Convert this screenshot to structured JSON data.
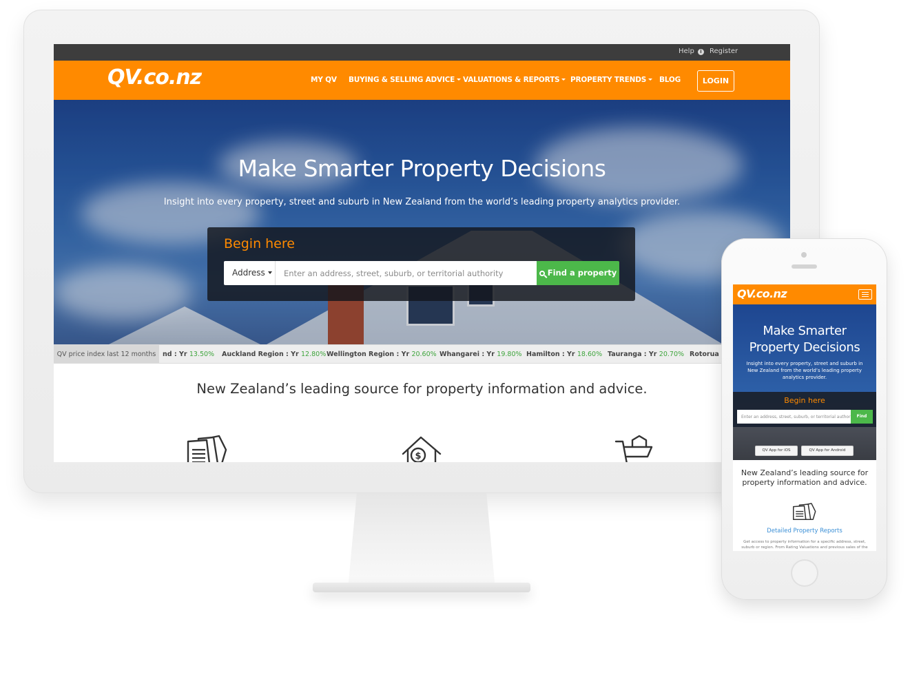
{
  "desktop": {
    "utility_links": {
      "help": "Help",
      "help_icon": "info-icon",
      "register": "Register"
    },
    "logo": "QV.co.nz",
    "nav": {
      "items": [
        {
          "label": "MY QV",
          "dropdown": false
        },
        {
          "label": "BUYING & SELLING ADVICE",
          "dropdown": true
        },
        {
          "label": "VALUATIONS & REPORTS",
          "dropdown": true
        },
        {
          "label": "PROPERTY TRENDS",
          "dropdown": true
        },
        {
          "label": "BLOG",
          "dropdown": false
        }
      ],
      "login": "LOGIN"
    },
    "hero": {
      "title": "Make Smarter Property Decisions",
      "subtitle": "Insight into every property, street and suburb in New Zealand from the world’s leading property analytics provider.",
      "search": {
        "heading": "Begin here",
        "type_selected": "Address",
        "placeholder": "Enter an address, street, suburb, or territorial authority",
        "button": "Find a property",
        "button_icon": "search-icon"
      }
    },
    "ticker": {
      "label": "QV price index last 12 months",
      "items": [
        {
          "name": "nd : Yr ",
          "value": "13.50%"
        },
        {
          "name": "Auckland Region : Yr ",
          "value": "12.80%"
        },
        {
          "name": "Wellington Region : Yr ",
          "value": "20.60%"
        },
        {
          "name": "Whangarei : Yr ",
          "value": "19.80%"
        },
        {
          "name": "Hamilton : Yr ",
          "value": "18.60%"
        },
        {
          "name": "Tauranga : Yr ",
          "value": "20.70%"
        },
        {
          "name": "Rotorua : ",
          "value": ""
        }
      ]
    },
    "tagline": "New Zealand’s leading source for property information and advice.",
    "feature_icons": [
      "documents-icon",
      "house-dollar-icon",
      "cart-house-icon"
    ]
  },
  "mobile": {
    "logo": "QV.co.nz",
    "menu_icon": "hamburger-menu-icon",
    "hero": {
      "title_line1": "Make Smarter",
      "title_line2": "Property Decisions",
      "subtitle": "Insight into every property, street and suburb in New Zealand from the world’s leading property analytics provider.",
      "search_heading": "Begin here",
      "placeholder": "Enter an address, street, suburb, or territorial authority",
      "button": "Find"
    },
    "apps": {
      "ios": "QV App for iOS",
      "android": "QV App for Android"
    },
    "tagline": "New Zealand’s leading source for property information and advice.",
    "feature_link": "Detailed Property Reports",
    "feature_desc": "Get access to property information for a specific address, street, suburb or region. From Rating Valuations and previous sales of the"
  },
  "colors": {
    "brand_orange": "#ff8a00",
    "find_green": "#4cb84a",
    "ticker_green": "#3fa53d",
    "link_blue": "#3a8fd6"
  }
}
